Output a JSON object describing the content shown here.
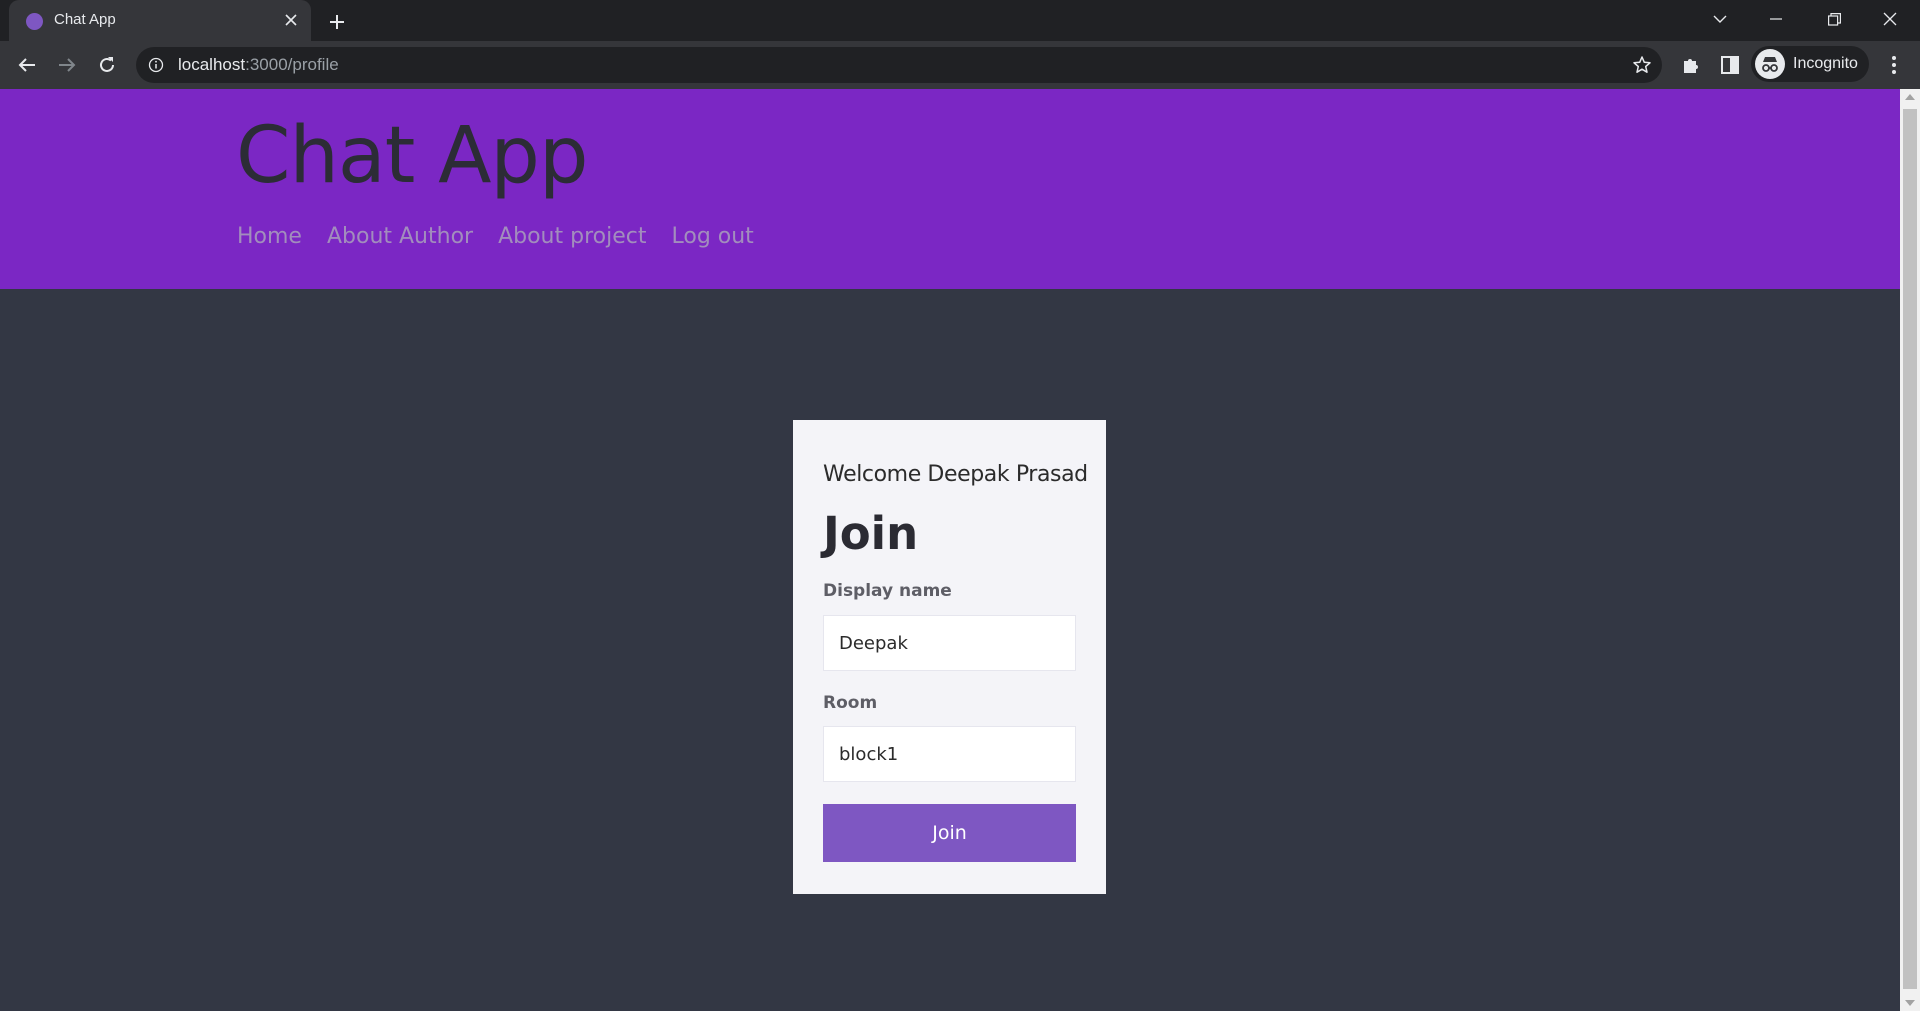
{
  "browser": {
    "tab_title": "Chat App",
    "url_host": "localhost",
    "url_path": ":3000/profile",
    "profile_label": "Incognito"
  },
  "header": {
    "brand": "Chat App",
    "nav": [
      "Home",
      "About Author",
      "About project",
      "Log out"
    ]
  },
  "card": {
    "welcome": "Welcome Deepak Prasad",
    "title": "Join",
    "display_name_label": "Display name",
    "display_name_value": "Deepak",
    "room_label": "Room",
    "room_value": "block1",
    "submit_label": "Join"
  },
  "colors": {
    "header_bg": "#7b27c4",
    "page_bg": "#333744",
    "button_bg": "#7e57c2",
    "nav_link": "#a28dbd"
  }
}
